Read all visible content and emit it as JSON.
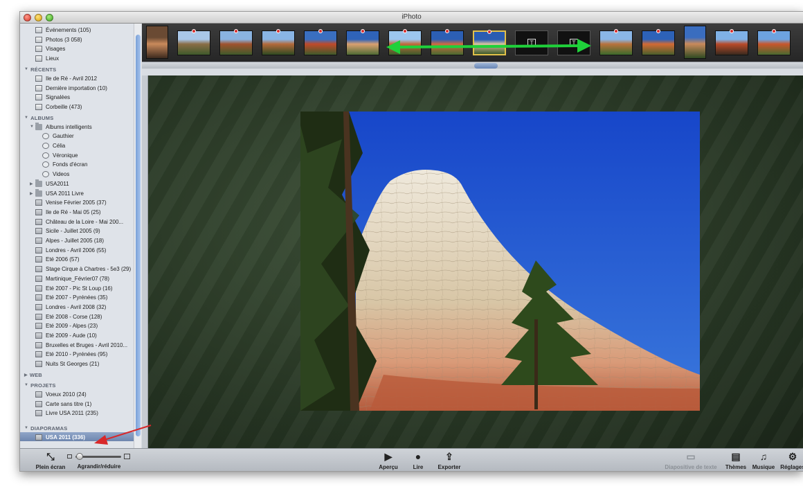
{
  "window": {
    "title": "iPhoto"
  },
  "sidebar": {
    "library": [
      {
        "label": "Événements (105)",
        "icon": "events-icon"
      },
      {
        "label": "Photos (3 058)",
        "icon": "photos-icon"
      },
      {
        "label": "Visages",
        "icon": "faces-icon"
      },
      {
        "label": "Lieux",
        "icon": "places-icon"
      }
    ],
    "recents_heading": "RÉCENTS",
    "recents": [
      {
        "label": "Ile de Ré - Avril 2012",
        "icon": "event-icon"
      },
      {
        "label": "Dernière importation (10)",
        "icon": "clock-icon"
      },
      {
        "label": "Signalées",
        "icon": "flag-icon"
      },
      {
        "label": "Corbeille (473)",
        "icon": "trash-icon"
      }
    ],
    "albums_heading": "ALBUMS",
    "smart_folder": {
      "label": "Albums intelligents",
      "icon": "folder-icon"
    },
    "smart_albums": [
      {
        "label": "Gauthier",
        "icon": "smart-album-icon"
      },
      {
        "label": "Célia",
        "icon": "smart-album-icon"
      },
      {
        "label": "Véronique",
        "icon": "smart-album-icon"
      },
      {
        "label": "Fonds d'écran",
        "icon": "smart-album-icon"
      },
      {
        "label": "Videos",
        "icon": "smart-album-icon"
      }
    ],
    "folders": [
      {
        "label": "USA2011",
        "icon": "folder-icon"
      },
      {
        "label": "USA 2011 Livre",
        "icon": "folder-icon"
      }
    ],
    "albums": [
      "Venise Février 2005 (37)",
      "Ile de Ré - Mai 05 (25)",
      "Château de la Loire - Mai 200...",
      "Sicile - Juillet 2005 (9)",
      "Alpes - Juillet 2005 (18)",
      "Londres - Avril 2006 (55)",
      "Eté 2006 (57)",
      "Stage Cirque à Chartres - 5e3 (29)",
      "Martinique_Février07 (78)",
      "Eté 2007 - Pic St Loup  (16)",
      "Eté 2007 - Pyrénées (35)",
      "Londres - Avril 2008 (32)",
      "Eté 2008 - Corse (128)",
      "Eté 2009 - Alpes (23)",
      "Eté 2009 - Aude (10)",
      "Bruxelles et Bruges - Avril 2010...",
      "Eté 2010 - Pyrénées (95)",
      "Nuits St Georges (21)"
    ],
    "web_heading": "WEB",
    "projects_heading": "PROJETS",
    "projects": [
      "Voeux 2010 (24)",
      "Carte sans titre (1)",
      "Livre USA 2011 (235)"
    ],
    "slideshows_heading": "DIAPORAMAS",
    "slideshows": [
      "USA 2011 (336)"
    ]
  },
  "filmstrip": {
    "thumbnails": [
      {
        "kind": "photo",
        "colors": [
          "#6a4a33",
          "#c98a5b",
          "#3d2a1e"
        ],
        "portrait": true,
        "flag": false
      },
      {
        "kind": "photo",
        "colors": [
          "#a9c7e8",
          "#8a6d46",
          "#3f5a2b"
        ],
        "flag": true
      },
      {
        "kind": "photo",
        "colors": [
          "#8ab3e0",
          "#a0522d",
          "#3f5a2b"
        ],
        "flag": true
      },
      {
        "kind": "photo",
        "colors": [
          "#89b5e5",
          "#b3693a",
          "#2f4a22"
        ],
        "flag": true
      },
      {
        "kind": "photo",
        "colors": [
          "#3a6fc0",
          "#c04a2a",
          "#3f5a2b"
        ],
        "flag": true
      },
      {
        "kind": "photo",
        "colors": [
          "#2f63b8",
          "#d9a070",
          "#4f6b34"
        ],
        "flag": true
      },
      {
        "kind": "photo",
        "colors": [
          "#9cc6ee",
          "#c06a3a",
          "#3d5a2b"
        ],
        "flag": true
      },
      {
        "kind": "photo",
        "colors": [
          "#2c5fb4",
          "#cf6a40",
          "#4a6a30"
        ],
        "flag": true
      },
      {
        "kind": "photo",
        "colors": [
          "#2a5cb2",
          "#d8c3a0",
          "#3f5a2b"
        ],
        "flag": true,
        "selected": true
      },
      {
        "kind": "text",
        "label": "T"
      },
      {
        "kind": "text",
        "label": "T"
      },
      {
        "kind": "photo",
        "colors": [
          "#8ab6e6",
          "#b8723c",
          "#3c6a2c"
        ],
        "flag": true
      },
      {
        "kind": "photo",
        "colors": [
          "#2d62b8",
          "#d26a34",
          "#4a5f2c"
        ],
        "flag": true
      },
      {
        "kind": "photo",
        "colors": [
          "#3a6dbf",
          "#c98a5b",
          "#2f4a22"
        ],
        "portrait": true,
        "flag": false
      },
      {
        "kind": "photo",
        "colors": [
          "#7fb1e6",
          "#b84a2a",
          "#3a2a1e"
        ],
        "flag": true
      },
      {
        "kind": "photo",
        "colors": [
          "#6da3e0",
          "#c8562c",
          "#4a6a30"
        ],
        "flag": true
      }
    ]
  },
  "toolbar": {
    "fullscreen_label": "Plein écran",
    "zoom_label": "Agrandir/réduire",
    "zoom_level": 0.05,
    "preview_label": "Aperçu",
    "play_label": "Lire",
    "export_label": "Exporter",
    "text_slide_label": "Diapositive de texte",
    "themes_label": "Thèmes",
    "music_label": "Musique",
    "settings_label": "Réglages"
  }
}
